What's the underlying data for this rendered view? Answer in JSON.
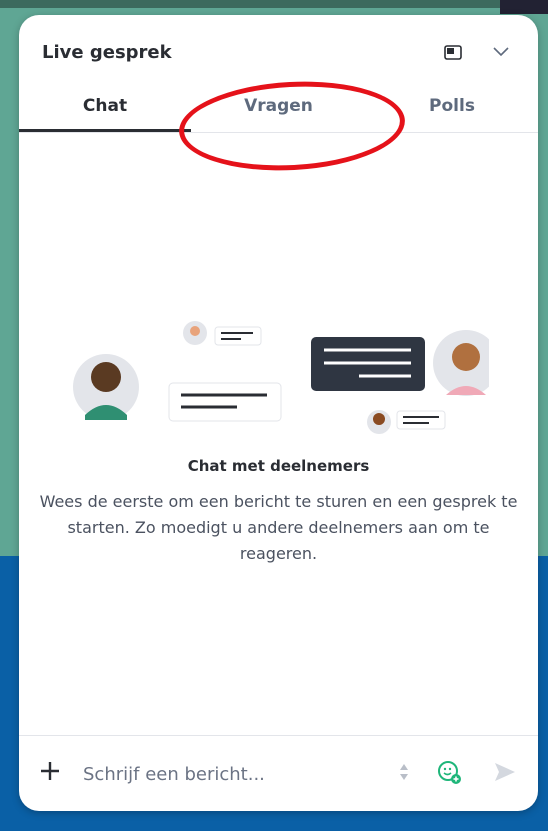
{
  "header": {
    "title": "Live gesprek"
  },
  "tabs": [
    {
      "label": "Chat",
      "active": true
    },
    {
      "label": "Vragen",
      "active": false
    },
    {
      "label": "Polls",
      "active": false
    }
  ],
  "empty_state": {
    "title": "Chat met deelnemers",
    "description": "Wees de eerste om een bericht te sturen en een gesprek te starten. Zo moedigt u andere deelnemers aan om te reageren."
  },
  "composer": {
    "placeholder": "Schrijf een bericht..."
  },
  "colors": {
    "active_tab": "#2a2d33",
    "inactive_tab": "#5e6a7d",
    "annotation": "#e5121a",
    "emoji_accent": "#1fb67a"
  }
}
